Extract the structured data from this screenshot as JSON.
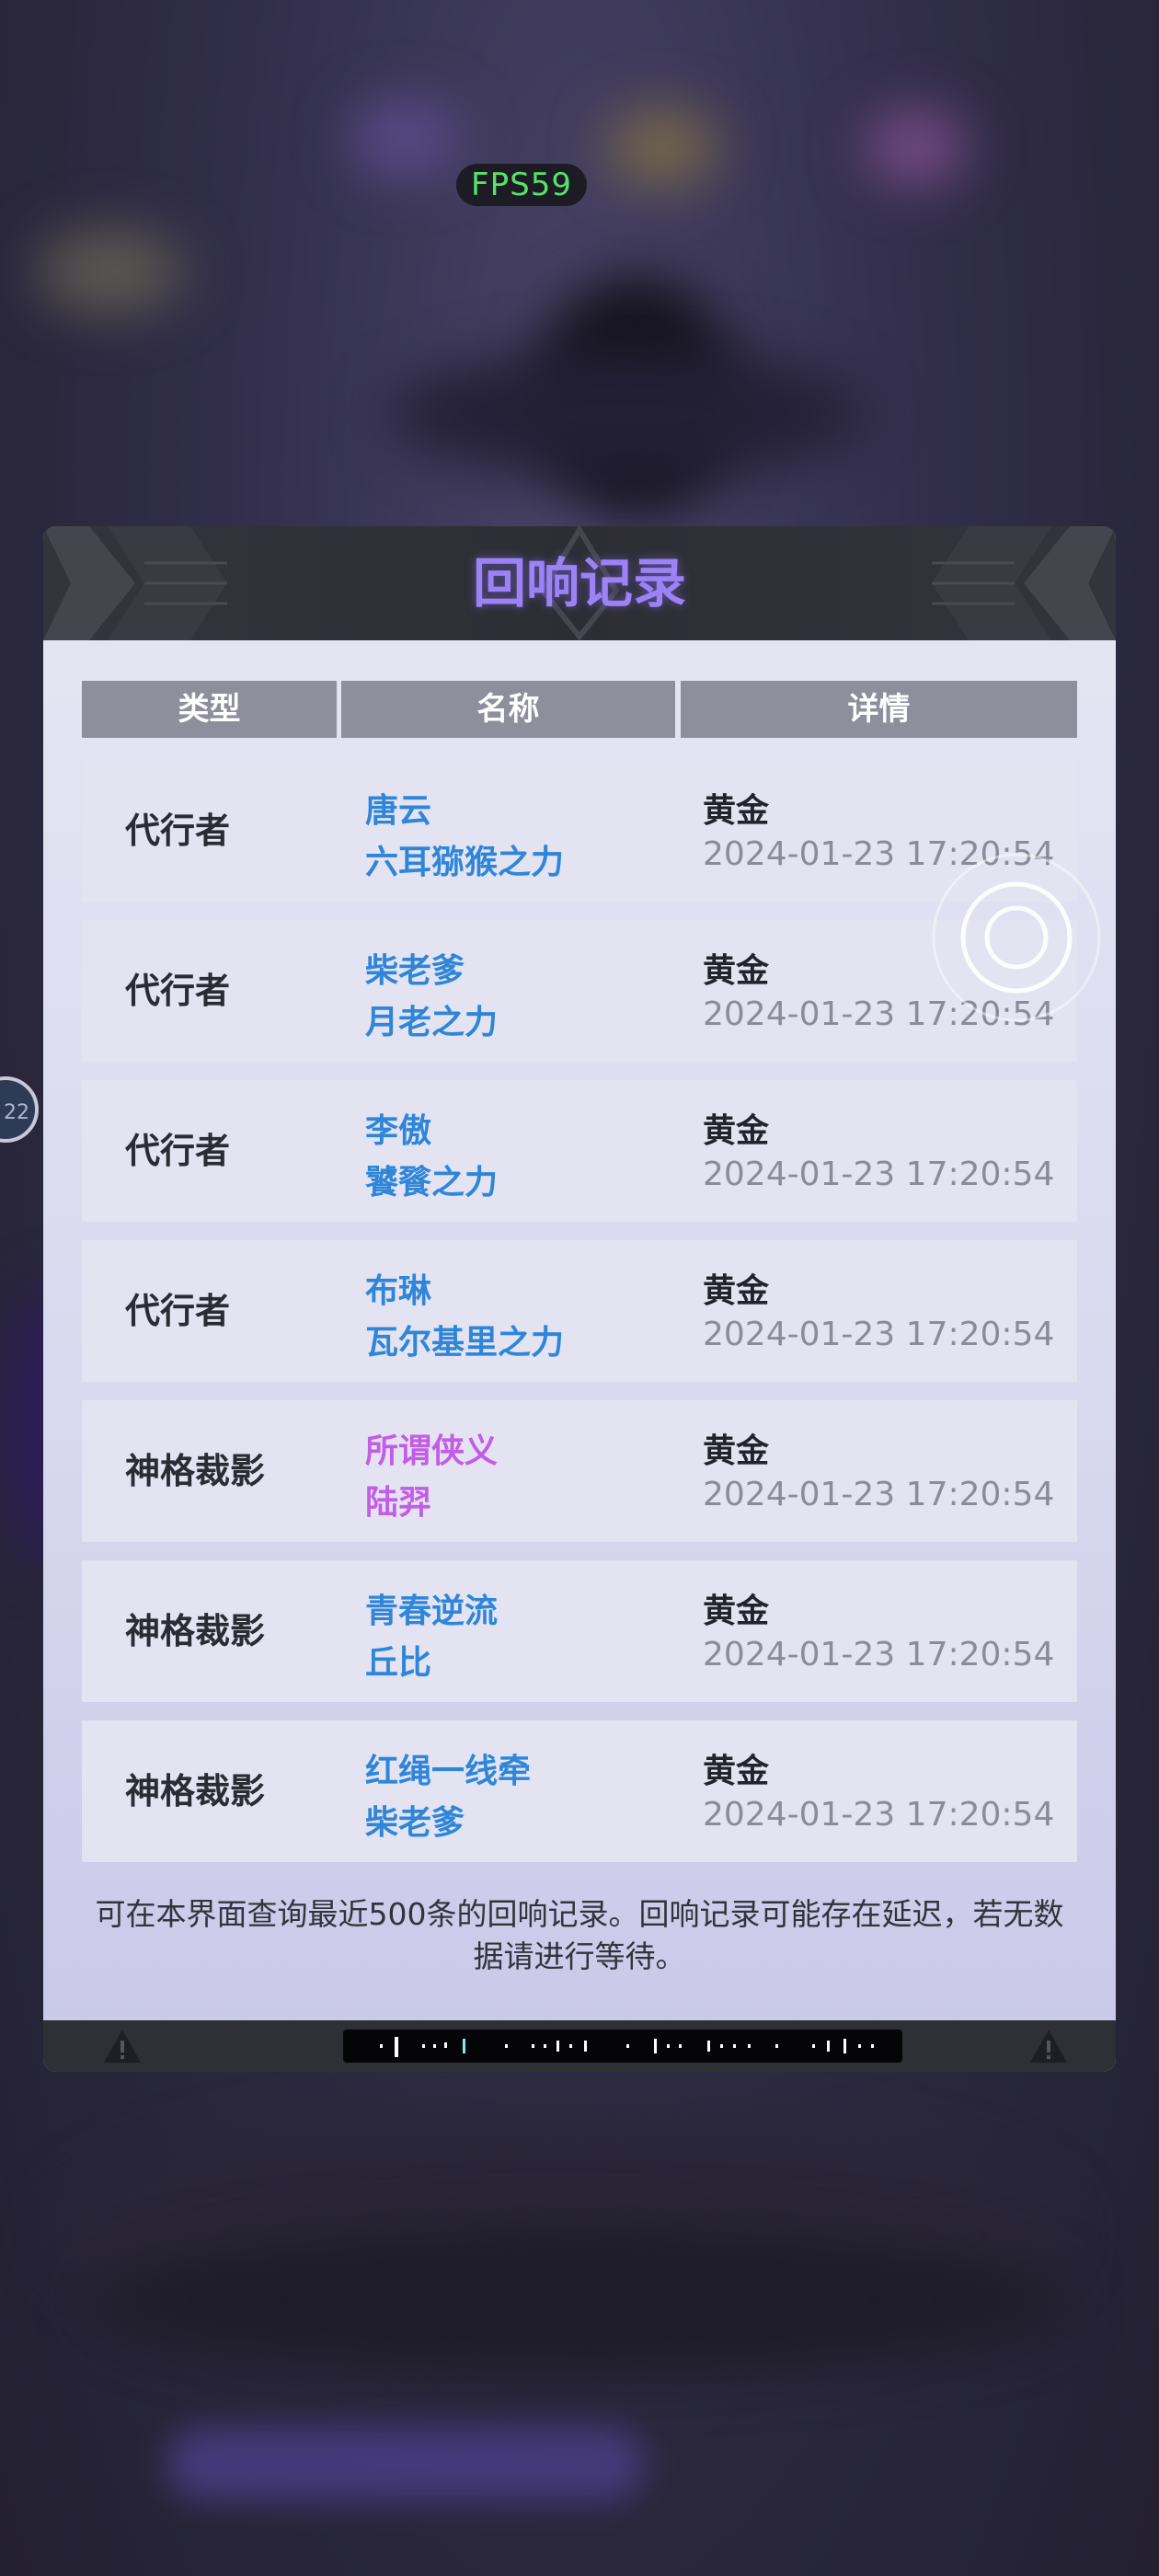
{
  "hud": {
    "fps": "FPS59",
    "side_button": "22"
  },
  "panel": {
    "title": "回响记录",
    "columns": [
      "类型",
      "名称",
      "详情"
    ],
    "rows": [
      {
        "type": "代行者",
        "name1": "唐云",
        "name2": "六耳猕猴之力",
        "quality": "黄金",
        "time": "2024-01-23 17:20:54",
        "name_color": "#2f86d8"
      },
      {
        "type": "代行者",
        "name1": "柴老爹",
        "name2": "月老之力",
        "quality": "黄金",
        "time": "2024-01-23 17:20:54",
        "name_color": "#2f86d8"
      },
      {
        "type": "代行者",
        "name1": "李傲",
        "name2": "饕餮之力",
        "quality": "黄金",
        "time": "2024-01-23 17:20:54",
        "name_color": "#2f86d8"
      },
      {
        "type": "代行者",
        "name1": "布琳",
        "name2": "瓦尔基里之力",
        "quality": "黄金",
        "time": "2024-01-23 17:20:54",
        "name_color": "#2f86d8"
      },
      {
        "type": "神格裁影",
        "name1": "所谓侠义",
        "name2": "陆羿",
        "quality": "黄金",
        "time": "2024-01-23 17:20:54",
        "name_color": "#c35ce6"
      },
      {
        "type": "神格裁影",
        "name1": "青春逆流",
        "name2": "丘比",
        "quality": "黄金",
        "time": "2024-01-23 17:20:54",
        "name_color": "#2f86d8"
      },
      {
        "type": "神格裁影",
        "name1": "红绳一线牵",
        "name2": "柴老爹",
        "quality": "黄金",
        "time": "2024-01-23 17:20:54",
        "name_color": "#2f86d8"
      }
    ],
    "note": "可在本界面查询最近500条的回响记录。回响记录可能存在延迟，若无数据请进行等待。"
  },
  "colors": {
    "accent": "#9b82f5",
    "fps": "#54e36a",
    "header_bg": "#8e8e9c"
  },
  "icons": {
    "warning": "warning-icon",
    "joystick": "joystick-icon"
  }
}
